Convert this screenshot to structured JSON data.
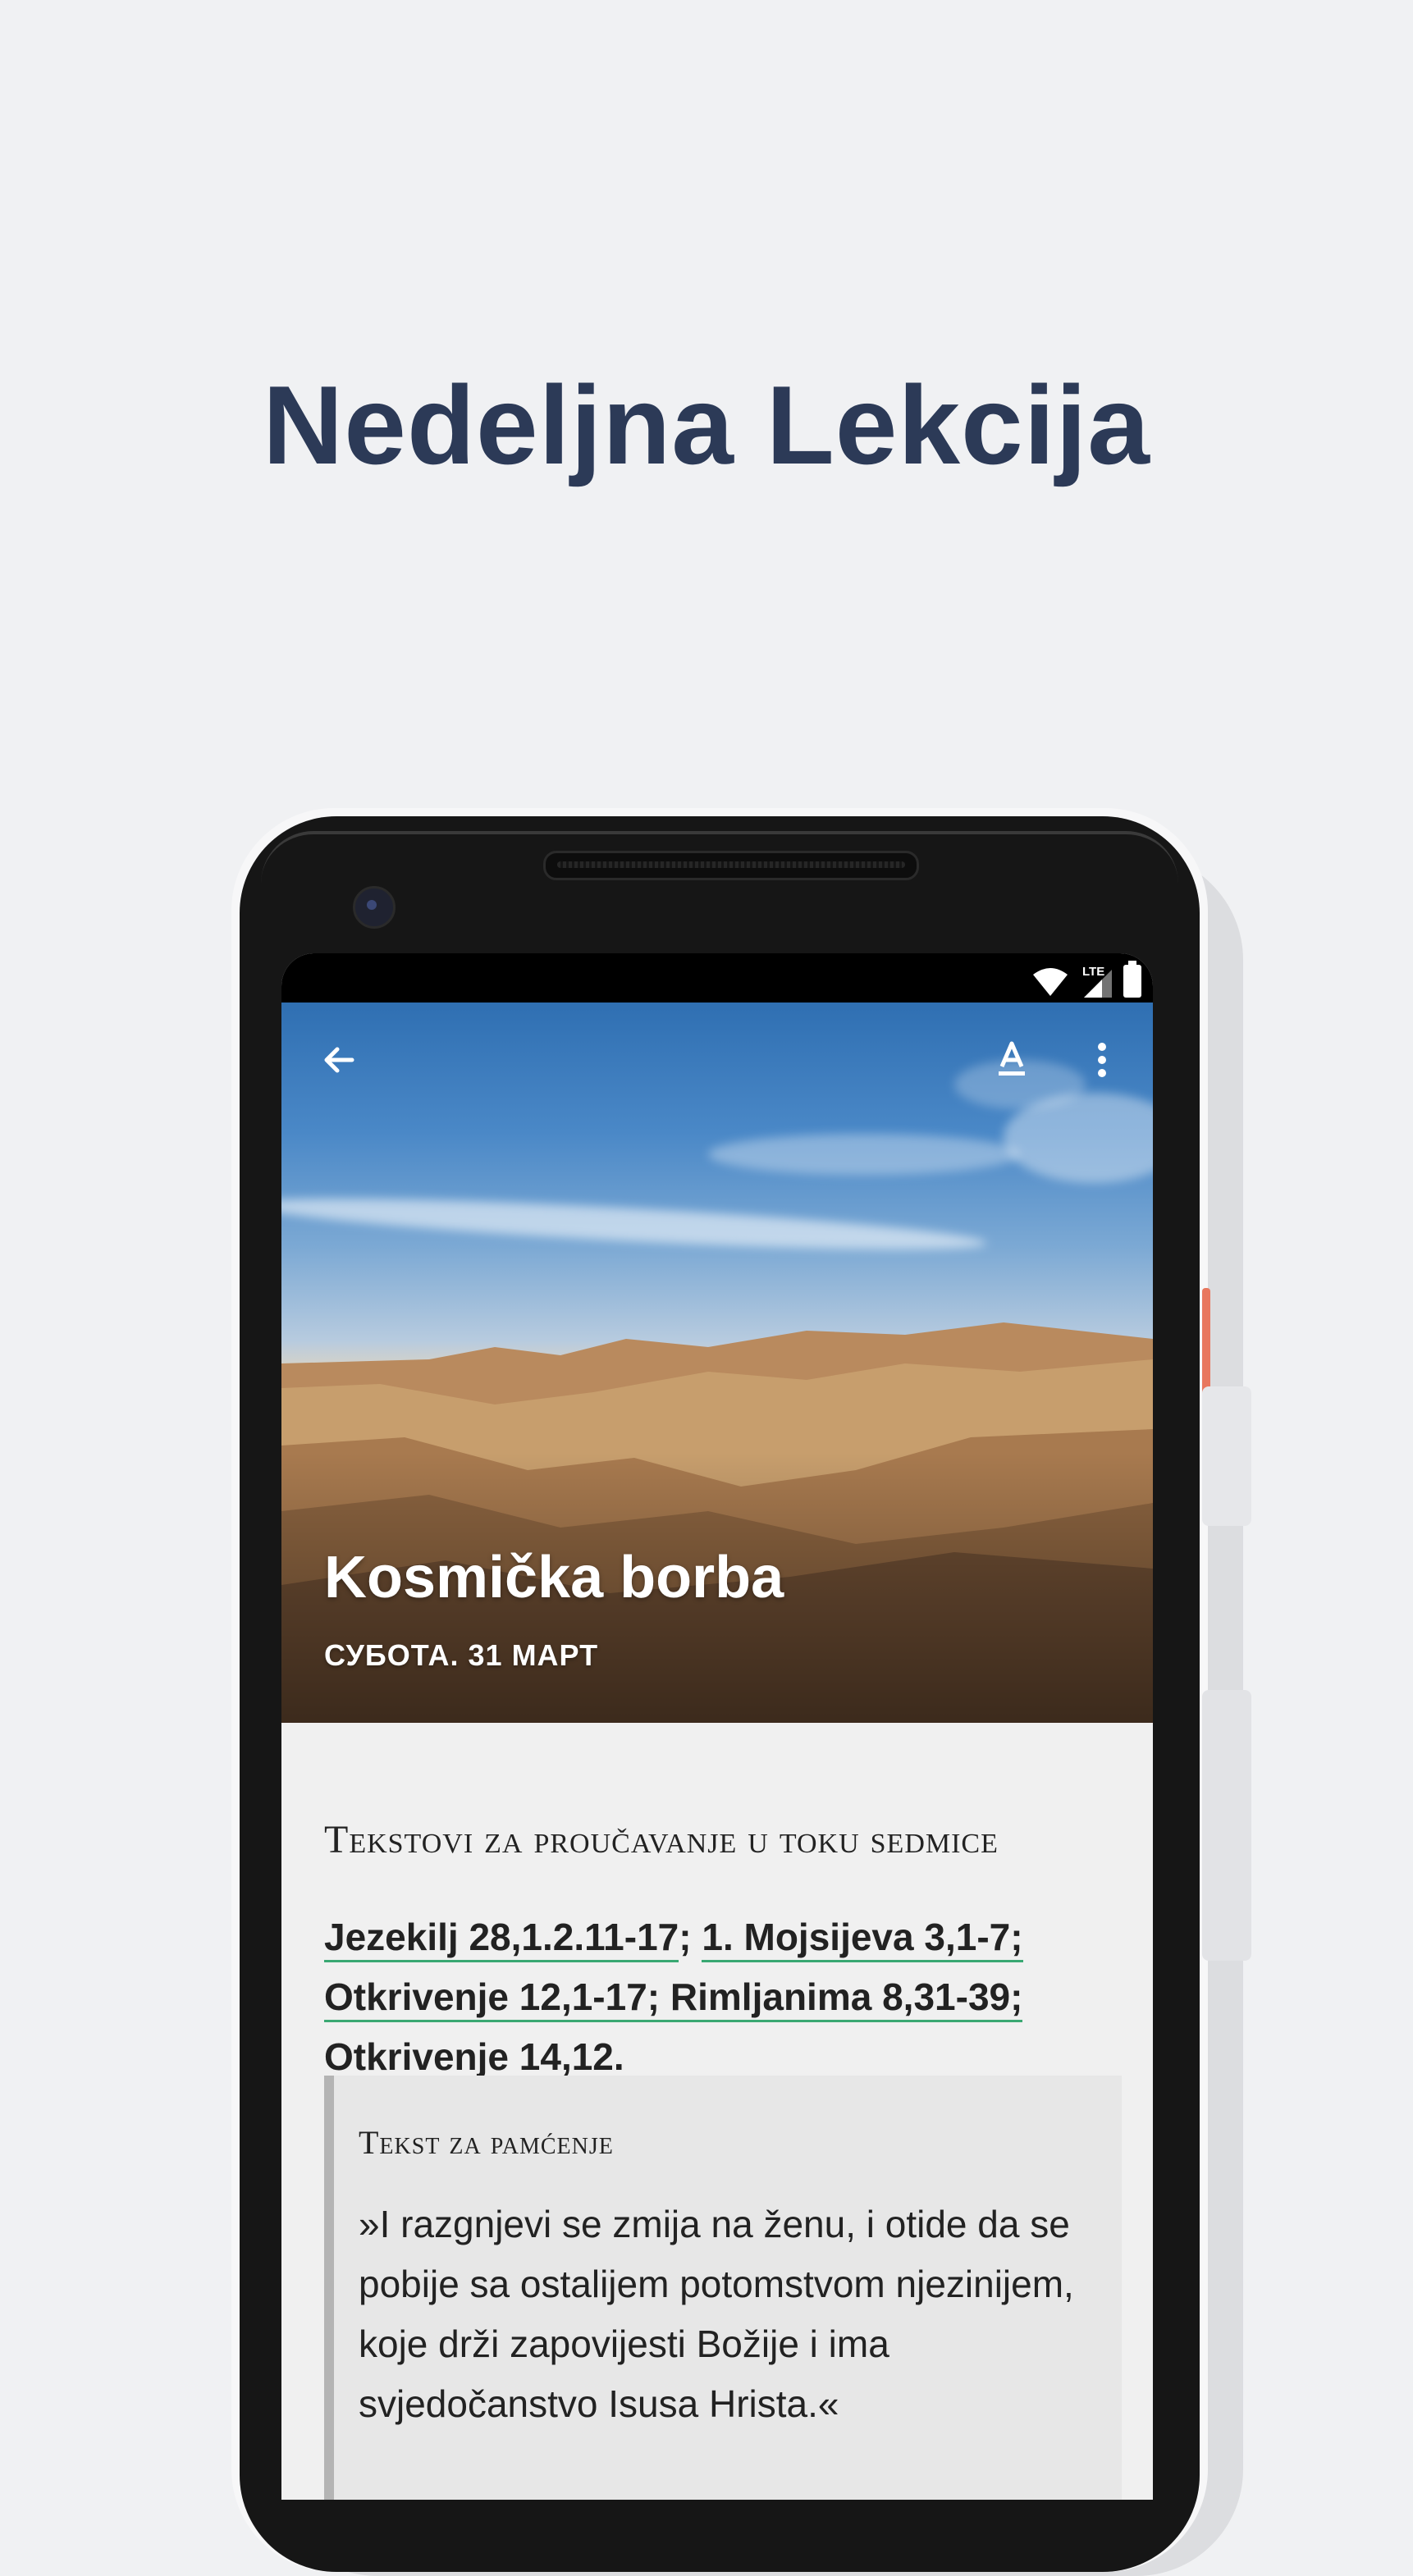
{
  "page": {
    "headline": "Nedeljna Lekcija"
  },
  "status_bar": {
    "network_label": "LTE",
    "icons": [
      "wifi-icon",
      "signal-icon",
      "battery-icon"
    ]
  },
  "toolbar": {
    "icons": [
      "back-arrow-icon",
      "font-size-icon",
      "more-vert-icon"
    ]
  },
  "lesson": {
    "title": "Kosmička borba",
    "date": "СУБОТА. 31 МАРТ"
  },
  "study": {
    "heading": "Tekstovi za proučavanje u toku sedmice",
    "lines": [
      [
        "Jezekilj 28,1.2.11-17",
        "; ",
        "1. Mojsijeva 3,1-7",
        ";"
      ],
      [
        "Otkrivenje 12,1-17",
        "; ",
        "Rimljanima 8,31-39",
        ";"
      ],
      [
        "Otkrivenje 14,12",
        "."
      ]
    ]
  },
  "memory": {
    "heading": "Tekst za pamćenje",
    "text": "»I razgnjevi se zmija na ženu, i otide da se pobije sa ostalijem potomstvom njezinijem, koje drži zapovijesti Božije i ima svjedočanstvo Isusa Hrista.«"
  },
  "colors": {
    "headline": "#2c3a57",
    "link_underline": "#3aa873",
    "accent_button": "#e8775e",
    "background": "#f0f1f3"
  }
}
